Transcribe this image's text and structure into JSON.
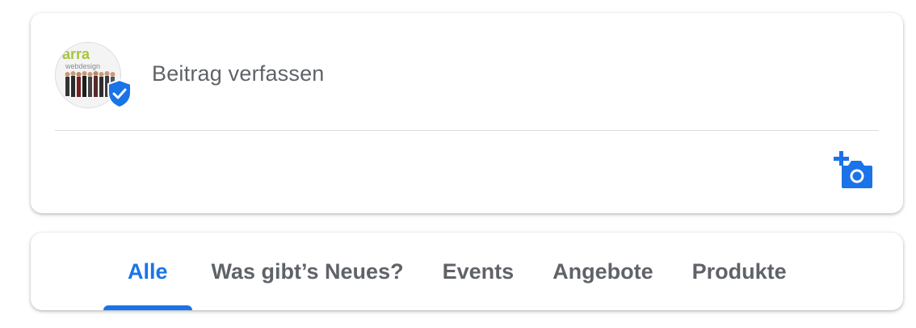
{
  "composer": {
    "avatar_logo_text": "arra",
    "avatar_logo_subtext": "webdesign",
    "prompt": "Beitrag verfassen",
    "add_photo_icon": "add-a-photo-icon",
    "verified_icon": "verified-shield-icon"
  },
  "tabs": [
    {
      "label": "Alle",
      "active": true
    },
    {
      "label": "Was gibt’s Neues?",
      "active": false
    },
    {
      "label": "Events",
      "active": false
    },
    {
      "label": "Angebote",
      "active": false
    },
    {
      "label": "Produkte",
      "active": false
    }
  ],
  "colors": {
    "accent": "#1a73e8",
    "text_secondary": "#5f6368",
    "divider": "#dadce0",
    "logo_green": "#a6c63b"
  }
}
